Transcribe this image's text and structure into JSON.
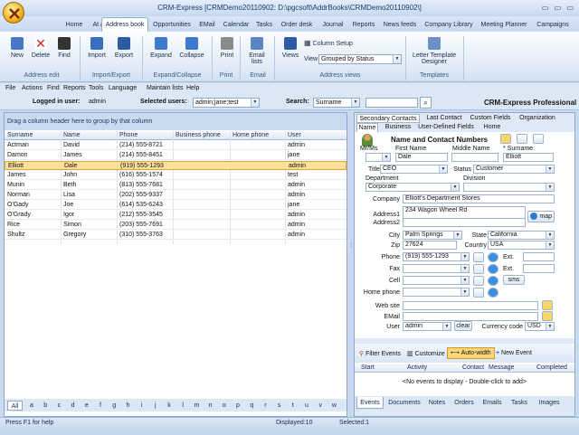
{
  "window": {
    "title": "CRM-Express [CRMDemo20110902: D:\\pgcsoft\\AddrBooks\\CRMDemo20110902\\]",
    "controls": "▭ ▭ ▭"
  },
  "tabs": [
    "Home",
    "At a glance",
    "Address book",
    "Opportunities",
    "EMail",
    "Calendar",
    "Tasks",
    "Order desk",
    "Journal",
    "Reports",
    "News feeds",
    "Company Library",
    "Meeting Planner",
    "Campaigns"
  ],
  "ribbon": {
    "buttons": [
      {
        "label": "New",
        "icon": "new-contact-icon"
      },
      {
        "label": "Delete",
        "icon": "delete-x-icon"
      },
      {
        "label": "Find",
        "icon": "binoculars-icon"
      },
      {
        "label": "Import",
        "icon": "import-icon"
      },
      {
        "label": "Export",
        "icon": "export-icon"
      },
      {
        "label": "Expand",
        "icon": "expand-icon"
      },
      {
        "label": "Collapse",
        "icon": "collapse-icon"
      },
      {
        "label": "Print",
        "icon": "printer-icon"
      },
      {
        "label": "Email lists",
        "icon": "email-lists-icon"
      },
      {
        "label": "Views",
        "icon": "views-icon"
      },
      {
        "label": "Letter Template Designer",
        "icon": "letter-template-icon"
      }
    ],
    "groups": [
      "Address edit",
      "Import/Export",
      "Expand/Collapse",
      "Print",
      "Email",
      "Address views",
      "Templates"
    ],
    "column_setup": "Column Setup",
    "view_label": "View",
    "view_value": "Grouped by Status"
  },
  "menu": [
    "File",
    "Actions",
    "Find",
    "Reports",
    "Tools",
    "Language",
    "Maintain lists",
    "Help"
  ],
  "info": {
    "logged_label": "Logged in user:",
    "logged_value": "admin",
    "selected_label": "Selected users:",
    "selected_value": "admin;jane;test",
    "search_label": "Search:",
    "search_field": "Surname",
    "search_value": "",
    "product": "CRM-Express Professional"
  },
  "grid": {
    "group_hint": "Drag a column header here to group by that column",
    "columns": [
      "Surname",
      "Name",
      "Phone",
      "Business phone",
      "Home phone",
      "User"
    ],
    "rows": [
      [
        "Actman",
        "David",
        "(214) 555-8721",
        "",
        "",
        "admin"
      ],
      [
        "Damon",
        "James",
        "(214) 555-8451",
        "",
        "",
        "jane"
      ],
      [
        "Elliott",
        "Dale",
        "(919) 555-1293",
        "",
        "",
        "admin"
      ],
      [
        "James",
        "John",
        "(616) 555-1574",
        "",
        "",
        "test"
      ],
      [
        "Munin",
        "Beth",
        "(813) 555-7681",
        "",
        "",
        "admin"
      ],
      [
        "Norman",
        "Lisa",
        "(202) 555-9337",
        "",
        "",
        "admin"
      ],
      [
        "O'Gady",
        "Joe",
        "(614) 535-6243",
        "",
        "",
        "jane"
      ],
      [
        "O'Grady",
        "Igor",
        "(212) 555-3545",
        "",
        "",
        "admin"
      ],
      [
        "Rice",
        "Simon",
        "(203) 555-7691",
        "",
        "",
        "admin"
      ],
      [
        "Shultz",
        "Gregory",
        "(310) 555-3763",
        "",
        "",
        "admin"
      ]
    ]
  },
  "alphabet": [
    "All",
    "a",
    "b",
    "c",
    "d",
    "e",
    "f",
    "g",
    "h",
    "i",
    "j",
    "k",
    "l",
    "m",
    "n",
    "o",
    "p",
    "q",
    "r",
    "s",
    "t",
    "u",
    "v",
    "w"
  ],
  "detail": {
    "top_tabs": [
      "Secondary Contacts",
      "Last Contact",
      "Custom Fields",
      "Organization"
    ],
    "sub_tabs": [
      "Name",
      "Business",
      "User-Defined Fields",
      "Home"
    ],
    "section_title": "Name and Contact Numbers",
    "labels": {
      "mrms": "Mr/Ms",
      "first": "First Name",
      "middle": "Middle Name",
      "surname": "* Surname",
      "title": "Title",
      "status": "Status",
      "department": "Department",
      "division": "Division",
      "company": "Company",
      "address1": "Address1",
      "address2": "Address2",
      "city": "City",
      "state": "State",
      "zip": "Zip",
      "country": "Country",
      "phone": "Phone",
      "fax": "Fax",
      "cell": "Cell",
      "homephone": "Home phone",
      "website": "Web site",
      "email": "EMail",
      "user": "User",
      "currency": "Currency code",
      "ext": "Ext.",
      "sms": "sms",
      "map": "map",
      "clear": "clear"
    },
    "values": {
      "first": "Dale",
      "surname": "Elliott",
      "title": "CEO",
      "status": "Customer",
      "department": "Corporate",
      "company": "Elliott's Department Stores",
      "address1": "234 Wagon Wheel Rd",
      "city": "Palm Springs",
      "state": "California",
      "zip": "27624",
      "country": "USA",
      "phone": "(919) 555-1293",
      "user": "admin",
      "currency": "USD"
    }
  },
  "events": {
    "toolbar": [
      "Filter Events",
      "Customize",
      "Auto-width",
      "New Event"
    ],
    "columns": [
      "Start",
      "Activity",
      "Contact",
      "Message",
      "Completed"
    ],
    "empty": "<No events to display - Double-click to add>",
    "tabs": [
      "Events",
      "Documents",
      "Notes",
      "Orders",
      "Emails",
      "Tasks",
      "Images"
    ]
  },
  "status": {
    "help": "Press F1 for help",
    "displayed": "Displayed:10",
    "selected": "Selected:1"
  },
  "colors": {
    "accent": "#f3b624",
    "selected_row": "#fde0a0",
    "frame": "#c9d9ee"
  }
}
